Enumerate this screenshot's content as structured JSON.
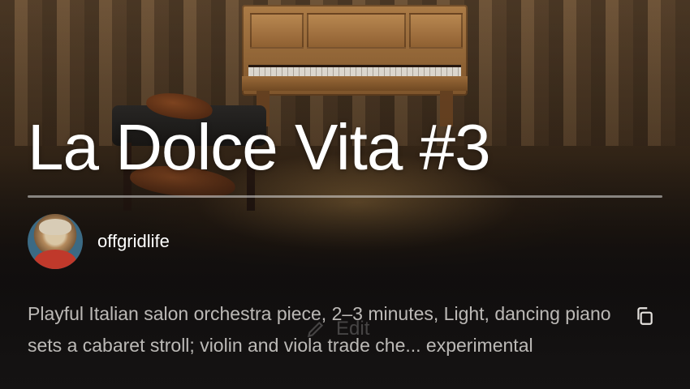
{
  "song": {
    "title": "La Dolce Vita #3",
    "author": "offgridlife",
    "description": "Playful Italian salon orchestra piece, 2–3 minutes, Light, dancing piano sets a cabaret stroll; violin and viola trade che... experimental"
  },
  "actions": {
    "edit_label": "Edit"
  },
  "icons": {
    "copy": "copy-icon",
    "edit": "pencil-icon"
  },
  "colors": {
    "background": "#141212",
    "title": "#ffffff",
    "description": "#dcd9d5"
  }
}
